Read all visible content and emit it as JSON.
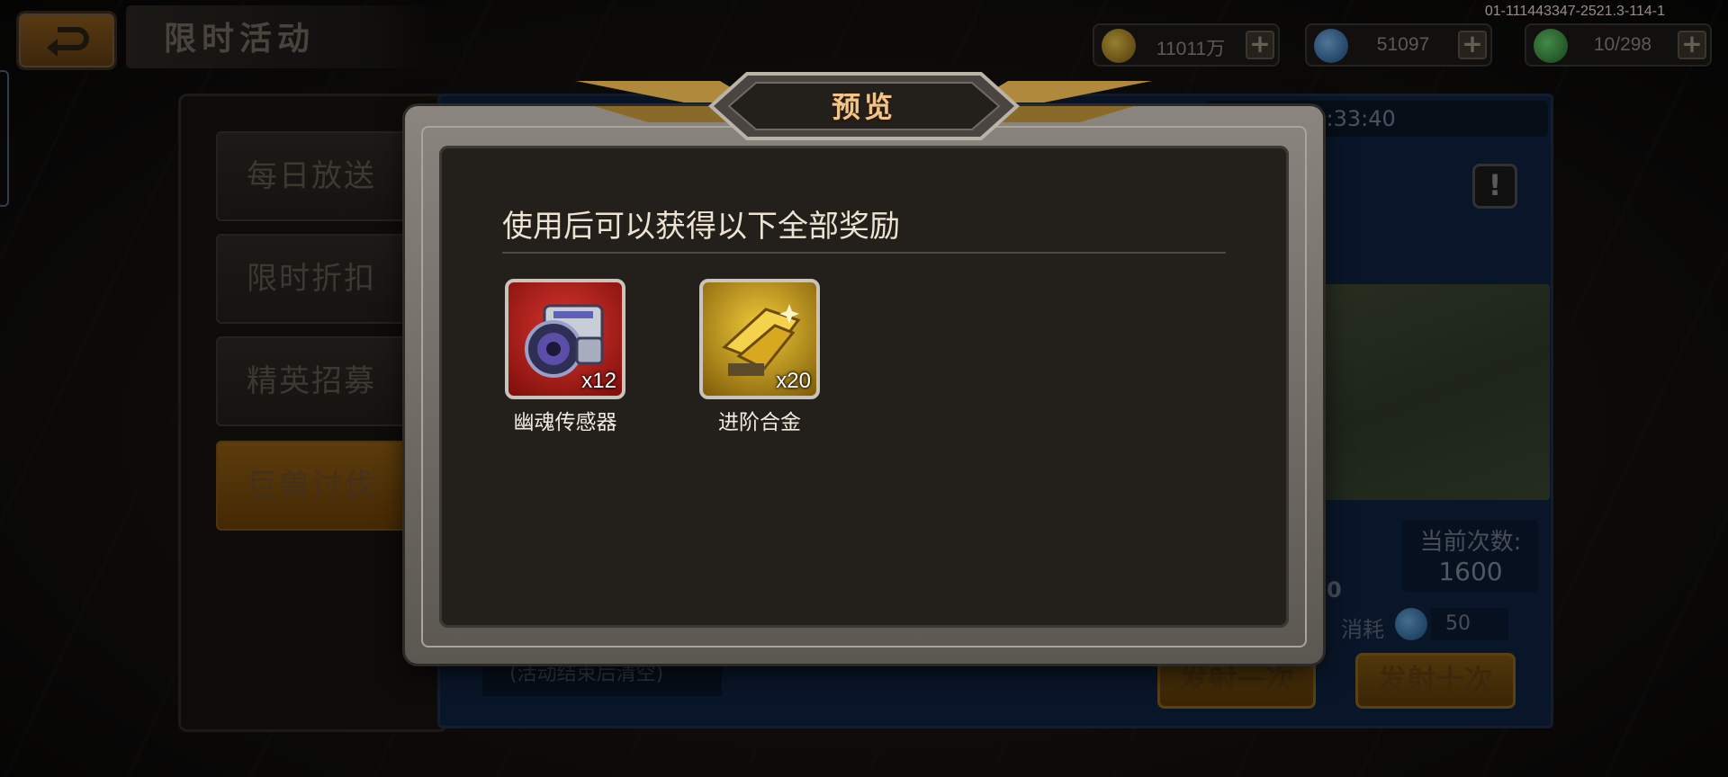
{
  "topbar": {
    "title": "限时活动",
    "version": "01-111443347-2521.3-114-1",
    "currencies": [
      {
        "name": "gold",
        "value": "11011万",
        "icon": "gold-coin-icon",
        "color": "#c8a02a"
      },
      {
        "name": "crystal",
        "value": "51097",
        "icon": "blue-crystal-icon",
        "color": "#3f86c8"
      },
      {
        "name": "energy",
        "value": "10/298",
        "icon": "green-energy-icon",
        "color": "#3ca24a"
      }
    ],
    "plus_label": "+"
  },
  "sidebar": {
    "items": [
      {
        "label": "每日放送"
      },
      {
        "label": "限时折扣"
      },
      {
        "label": "精英招募"
      },
      {
        "label": "巨兽讨伐"
      }
    ]
  },
  "panel": {
    "timer": "时: 6天12:33:40",
    "info_label": "!",
    "count_label": "当前次数:",
    "count_value": "1600",
    "partial_zero": "0",
    "cost_label": "消耗",
    "cost_value": "50",
    "footnote": "(活动结束后清空)",
    "fire_once": "发射一次",
    "fire_ten": "发射十次"
  },
  "modal": {
    "title": "预览",
    "description": "使用后可以获得以下全部奖励",
    "rewards": [
      {
        "name": "幽魂传感器",
        "quantity": "x12",
        "rarity_color": "#c0221d",
        "icon": "camera-sensor-icon"
      },
      {
        "name": "进阶合金",
        "quantity": "x20",
        "rarity_color": "#d8a820",
        "icon": "gold-alloy-icon"
      }
    ]
  }
}
